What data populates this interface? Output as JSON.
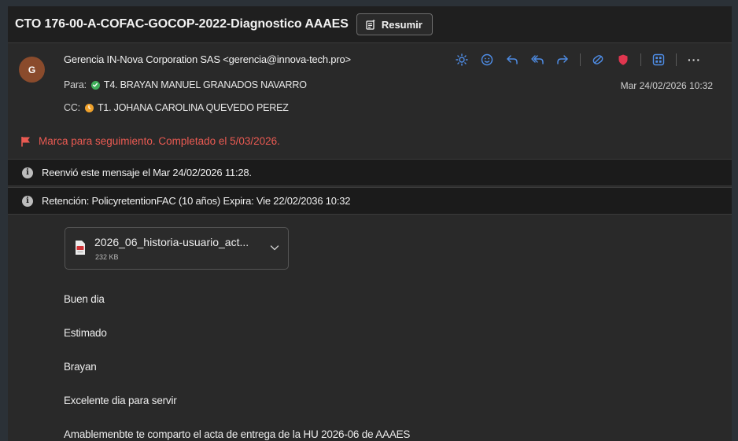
{
  "title_bar": {
    "subject": "CTO 176-00-A-COFAC-GOCOP-2022-Diagnostico AAAES",
    "summarize_label": "Resumir"
  },
  "message": {
    "avatar_initial": "G",
    "from": "Gerencia IN-Nova Corporation SAS <gerencia@innova-tech.pro>",
    "to_label": "Para:",
    "to": "T4. BRAYAN MANUEL GRANADOS NAVARRO",
    "cc_label": "CC:",
    "cc": "T1. JOHANA CAROLINA QUEVEDO PEREZ",
    "date": "Mar 24/02/2026 10:32",
    "actions": [
      "sun-icon",
      "emoji-icon",
      "reply-icon",
      "reply-all-icon",
      "forward-icon",
      "immersive-reader-icon",
      "shield-icon",
      "apps-icon",
      "more-icon"
    ],
    "more_label": "···"
  },
  "flag": {
    "text": "Marca para seguimiento. Completado el 5/03/2026.",
    "color": "#ea5a52"
  },
  "info_bars": [
    {
      "icon": "info-icon",
      "text": "Reenvió este mensaje el Mar 24/02/2026 11:28."
    },
    {
      "icon": "info-icon",
      "text": "Retención: PolicyretentionFAC (10 años) Expira: Vie 22/02/2036 10:32"
    }
  ],
  "attachment": {
    "icon": "pdf-file-icon",
    "name": "2026_06_historia-usuario_act...",
    "size": "232 KB"
  },
  "body": {
    "lines": [
      "Buen dia",
      "Estimado",
      "Brayan",
      "Excelente dia para servir",
      "Amablemenbte te comparto el acta de entrega de la HU 2026-06 de AAAES"
    ]
  },
  "colors": {
    "accent": "#4f8ee8",
    "status_available": "#3fae5a",
    "status_away": "#f0a22c",
    "shield": "#e0364f",
    "avatar": "#8a4b2c"
  }
}
